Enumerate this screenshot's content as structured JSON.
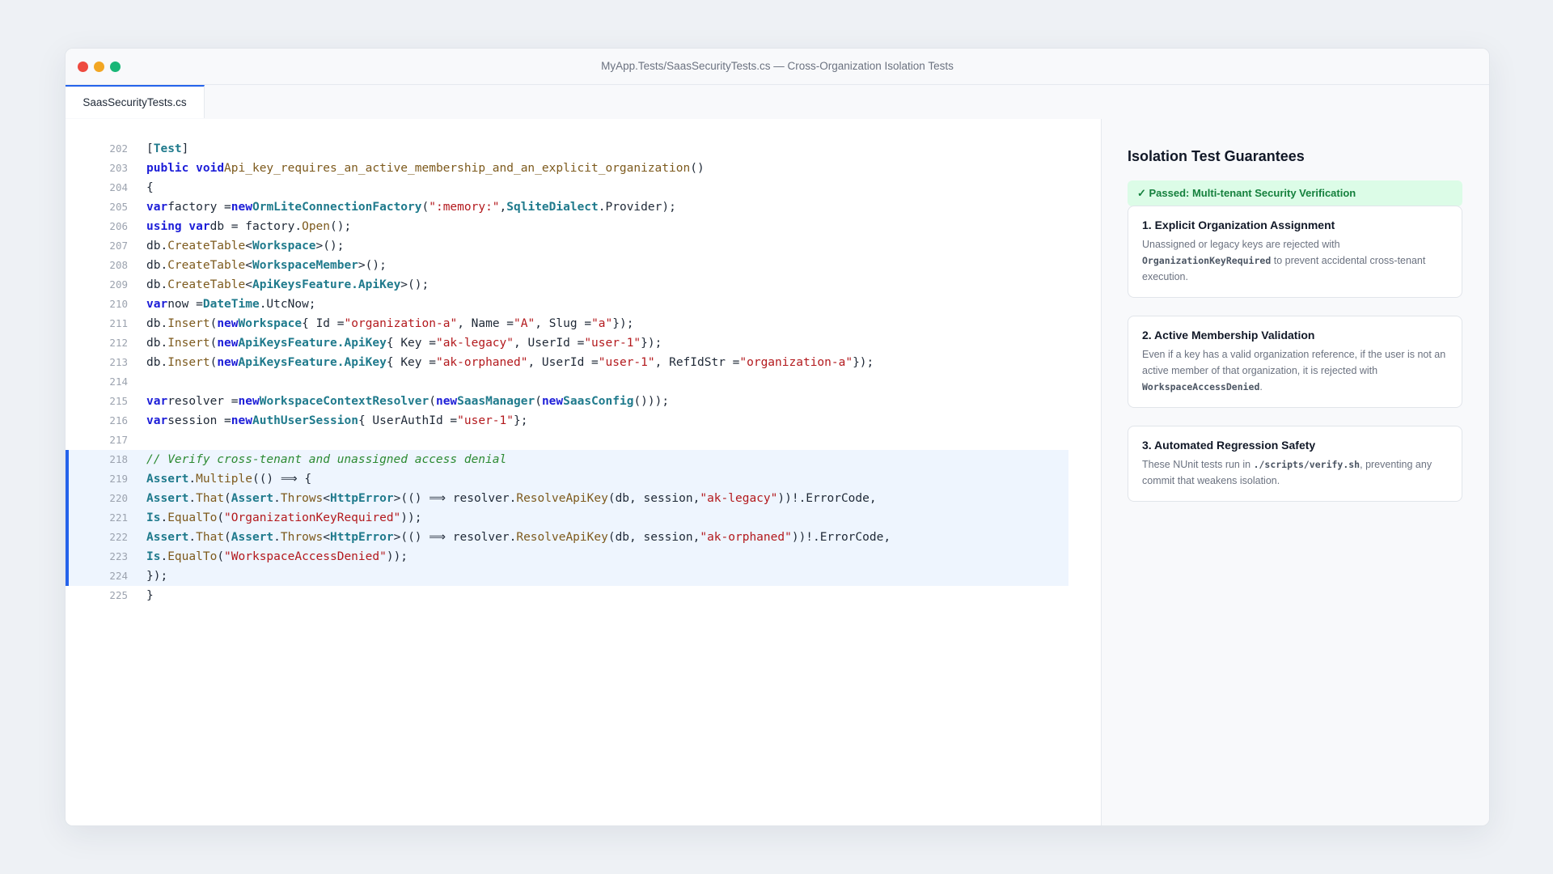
{
  "window": {
    "title": "MyApp.Tests/SaasSecurityTests.cs — Cross-Organization Isolation Tests",
    "tab_label": "SaasSecurityTests.cs"
  },
  "editor": {
    "highlight_range": [
      218,
      224
    ],
    "lines": [
      {
        "n": "202",
        "tokens": [
          [
            "p",
            "["
          ],
          [
            "t",
            "Test"
          ],
          [
            "p",
            "]"
          ]
        ]
      },
      {
        "n": "203",
        "tokens": [
          [
            "k",
            "public"
          ],
          [
            "p",
            " "
          ],
          [
            "k",
            "void"
          ],
          [
            "f",
            "Api_key_requires_an_active_membership_and_an_explicit_organization"
          ],
          [
            "p",
            "()"
          ]
        ]
      },
      {
        "n": "204",
        "tokens": [
          [
            "p",
            "{"
          ]
        ]
      },
      {
        "n": "205",
        "tokens": [
          [
            "k",
            "var"
          ],
          [
            "p",
            "factory ="
          ],
          [
            "k",
            "new"
          ],
          [
            "t",
            "OrmLiteConnectionFactory"
          ],
          [
            "p",
            "("
          ],
          [
            "s",
            "\":memory:\""
          ],
          [
            "p",
            ","
          ],
          [
            "t",
            "SqliteDialect"
          ],
          [
            "p",
            ".Provider);"
          ]
        ]
      },
      {
        "n": "206",
        "tokens": [
          [
            "k",
            "using"
          ],
          [
            "p",
            " "
          ],
          [
            "k",
            "var"
          ],
          [
            "p",
            "db = factory."
          ],
          [
            "f",
            "Open"
          ],
          [
            "p",
            "();"
          ]
        ]
      },
      {
        "n": "207",
        "tokens": [
          [
            "p",
            "db."
          ],
          [
            "f",
            "CreateTable"
          ],
          [
            "p",
            "<"
          ],
          [
            "t",
            "Workspace"
          ],
          [
            "p",
            ">();"
          ]
        ]
      },
      {
        "n": "208",
        "tokens": [
          [
            "p",
            "db."
          ],
          [
            "f",
            "CreateTable"
          ],
          [
            "p",
            "<"
          ],
          [
            "t",
            "WorkspaceMember"
          ],
          [
            "p",
            ">();"
          ]
        ]
      },
      {
        "n": "209",
        "tokens": [
          [
            "p",
            "db."
          ],
          [
            "f",
            "CreateTable"
          ],
          [
            "p",
            "<"
          ],
          [
            "t",
            "ApiKeysFeature.ApiKey"
          ],
          [
            "p",
            ">();"
          ]
        ]
      },
      {
        "n": "210",
        "tokens": [
          [
            "k",
            "var"
          ],
          [
            "p",
            "now ="
          ],
          [
            "t",
            "DateTime"
          ],
          [
            "p",
            ".UtcNow;"
          ]
        ]
      },
      {
        "n": "211",
        "tokens": [
          [
            "p",
            "db."
          ],
          [
            "f",
            "Insert"
          ],
          [
            "p",
            "("
          ],
          [
            "k",
            "new"
          ],
          [
            "t",
            "Workspace"
          ],
          [
            "p",
            "{ Id ="
          ],
          [
            "s",
            "\"organization-a\""
          ],
          [
            "p",
            ", Name ="
          ],
          [
            "s",
            "\"A\""
          ],
          [
            "p",
            ", Slug ="
          ],
          [
            "s",
            "\"a\""
          ],
          [
            "p",
            "});"
          ]
        ]
      },
      {
        "n": "212",
        "tokens": [
          [
            "p",
            "db."
          ],
          [
            "f",
            "Insert"
          ],
          [
            "p",
            "("
          ],
          [
            "k",
            "new"
          ],
          [
            "t",
            "ApiKeysFeature.ApiKey"
          ],
          [
            "p",
            "{ Key ="
          ],
          [
            "s",
            "\"ak-legacy\""
          ],
          [
            "p",
            ", UserId ="
          ],
          [
            "s",
            "\"user-1\""
          ],
          [
            "p",
            "});"
          ]
        ]
      },
      {
        "n": "213",
        "tokens": [
          [
            "p",
            "db."
          ],
          [
            "f",
            "Insert"
          ],
          [
            "p",
            "("
          ],
          [
            "k",
            "new"
          ],
          [
            "t",
            "ApiKeysFeature.ApiKey"
          ],
          [
            "p",
            "{ Key ="
          ],
          [
            "s",
            "\"ak-orphaned\""
          ],
          [
            "p",
            ", UserId ="
          ],
          [
            "s",
            "\"user-1\""
          ],
          [
            "p",
            ", RefIdStr ="
          ],
          [
            "s",
            "\"organization-a\""
          ],
          [
            "p",
            "});"
          ]
        ]
      },
      {
        "n": "214",
        "tokens": []
      },
      {
        "n": "215",
        "tokens": [
          [
            "k",
            "var"
          ],
          [
            "p",
            "resolver ="
          ],
          [
            "k",
            "new"
          ],
          [
            "t",
            "WorkspaceContextResolver"
          ],
          [
            "p",
            "("
          ],
          [
            "k",
            "new"
          ],
          [
            "t",
            "SaasManager"
          ],
          [
            "p",
            "("
          ],
          [
            "k",
            "new"
          ],
          [
            "t",
            "SaasConfig"
          ],
          [
            "p",
            "()));"
          ]
        ]
      },
      {
        "n": "216",
        "tokens": [
          [
            "k",
            "var"
          ],
          [
            "p",
            "session ="
          ],
          [
            "k",
            "new"
          ],
          [
            "t",
            "AuthUserSession"
          ],
          [
            "p",
            "{ UserAuthId ="
          ],
          [
            "s",
            "\"user-1\""
          ],
          [
            "p",
            "};"
          ]
        ]
      },
      {
        "n": "217",
        "tokens": []
      },
      {
        "n": "218",
        "tokens": [
          [
            "c",
            "// Verify cross-tenant and unassigned access denial"
          ]
        ]
      },
      {
        "n": "219",
        "tokens": [
          [
            "t",
            "Assert"
          ],
          [
            "p",
            "."
          ],
          [
            "f",
            "Multiple"
          ],
          [
            "p",
            "(() ⟹ {"
          ]
        ]
      },
      {
        "n": "220",
        "tokens": [
          [
            "t",
            "Assert"
          ],
          [
            "p",
            "."
          ],
          [
            "f",
            "That"
          ],
          [
            "p",
            "("
          ],
          [
            "t",
            "Assert"
          ],
          [
            "p",
            "."
          ],
          [
            "f",
            "Throws"
          ],
          [
            "p",
            "<"
          ],
          [
            "t",
            "HttpError"
          ],
          [
            "p",
            ">(() ⟹ resolver."
          ],
          [
            "f",
            "ResolveApiKey"
          ],
          [
            "p",
            "(db, session,"
          ],
          [
            "s",
            "\"ak-legacy\""
          ],
          [
            "p",
            "))!.ErrorCode,"
          ]
        ]
      },
      {
        "n": "221",
        "tokens": [
          [
            "t",
            "Is"
          ],
          [
            "p",
            "."
          ],
          [
            "f",
            "EqualTo"
          ],
          [
            "p",
            "("
          ],
          [
            "s",
            "\"OrganizationKeyRequired\""
          ],
          [
            "p",
            "));"
          ]
        ]
      },
      {
        "n": "222",
        "tokens": [
          [
            "t",
            "Assert"
          ],
          [
            "p",
            "."
          ],
          [
            "f",
            "That"
          ],
          [
            "p",
            "("
          ],
          [
            "t",
            "Assert"
          ],
          [
            "p",
            "."
          ],
          [
            "f",
            "Throws"
          ],
          [
            "p",
            "<"
          ],
          [
            "t",
            "HttpError"
          ],
          [
            "p",
            ">(() ⟹ resolver."
          ],
          [
            "f",
            "ResolveApiKey"
          ],
          [
            "p",
            "(db, session,"
          ],
          [
            "s",
            "\"ak-orphaned\""
          ],
          [
            "p",
            "))!.ErrorCode,"
          ]
        ]
      },
      {
        "n": "223",
        "tokens": [
          [
            "t",
            "Is"
          ],
          [
            "p",
            "."
          ],
          [
            "f",
            "EqualTo"
          ],
          [
            "p",
            "("
          ],
          [
            "s",
            "\"WorkspaceAccessDenied\""
          ],
          [
            "p",
            "));"
          ]
        ]
      },
      {
        "n": "224",
        "tokens": [
          [
            "p",
            "});"
          ]
        ]
      },
      {
        "n": "225",
        "tokens": [
          [
            "p",
            "}"
          ]
        ]
      }
    ]
  },
  "panel": {
    "title": "Isolation Test Guarantees",
    "passed_label": "✓ Passed: Multi-tenant Security Verification",
    "cards": [
      {
        "title": "1. Explicit Organization Assignment",
        "desc_before": "Unassigned or legacy keys are rejected with ",
        "desc_code": "OrganizationKeyRequired",
        "desc_after": " to prevent accidental cross-tenant execution."
      },
      {
        "title": "2. Active Membership Validation",
        "desc_before": "Even if a key has a valid organization reference, if the user is not an active member of that organization, it is rejected with ",
        "desc_code": "WorkspaceAccessDenied",
        "desc_after": "."
      },
      {
        "title": "3. Automated Regression Safety",
        "desc_before": "These NUnit tests run in ",
        "desc_code": "./scripts/verify.sh",
        "desc_after": ", preventing any commit that weakens isolation."
      }
    ]
  },
  "colors": {
    "accent": "#2563eb",
    "keyword": "#1d1ed8",
    "type": "#1f7a8c",
    "method": "#7d5a1d",
    "string": "#b3191d",
    "comment": "#2c8a32",
    "passed_bg": "#dcfce7",
    "passed_text": "#15803d"
  }
}
